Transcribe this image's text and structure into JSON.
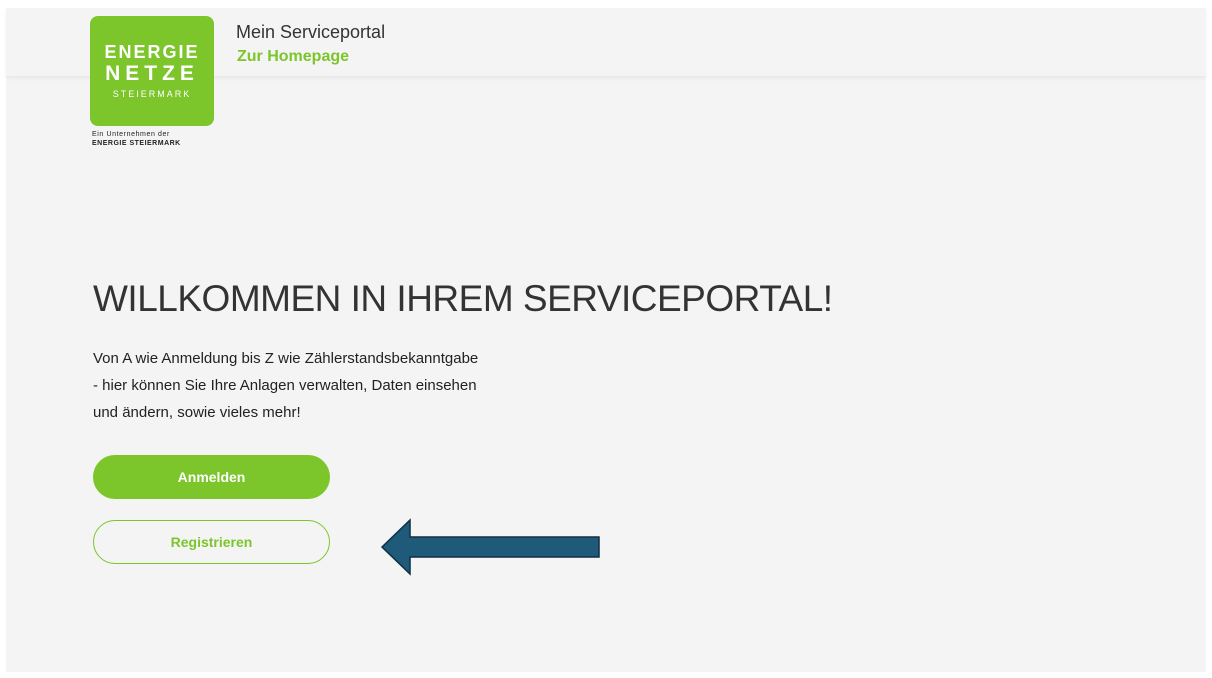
{
  "header": {
    "portal_title": "Mein Serviceportal",
    "homepage_link": "Zur Homepage"
  },
  "logo": {
    "line1": "ENERGIE",
    "line2": "NETZE",
    "line3": "STEIERMARK",
    "sub1": "Ein Unternehmen der",
    "sub2": "ENERGIE STEIERMARK",
    "color": "#7cc52b"
  },
  "main": {
    "headline": "WILLKOMMEN IN IHREM SERVICEPORTAL!",
    "intro_lines": [
      "Von A wie Anmeldung bis Z wie Zählerstandsbekanntgabe",
      "- hier können Sie Ihre Anlagen verwalten, Daten einsehen",
      "und ändern, sowie vieles mehr!"
    ],
    "login_label": "Anmelden",
    "register_label": "Registrieren"
  },
  "annotation": {
    "icon": "arrow-left-icon",
    "color": "#1f5a7a"
  },
  "colors": {
    "accent": "#7cc52b",
    "background": "#f4f4f4"
  }
}
